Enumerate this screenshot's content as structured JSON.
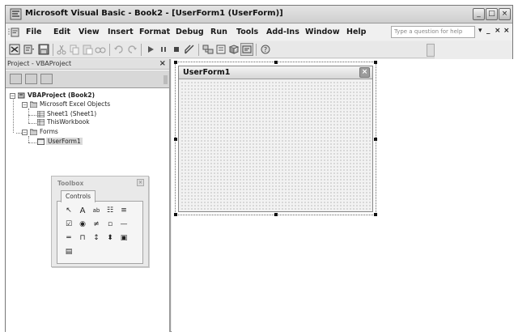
{
  "window": {
    "title": "Microsoft Visual Basic - Book2 - [UserForm1 (UserForm)]",
    "icon": "vba-app-icon"
  },
  "menubar": {
    "items": [
      "File",
      "Edit",
      "View",
      "Insert",
      "Format",
      "Debug",
      "Run",
      "Tools",
      "Add-Ins",
      "Window",
      "Help"
    ],
    "help_placeholder": "Type a question for help",
    "mdi_controls": [
      "▾",
      "_",
      "×",
      "×"
    ]
  },
  "window_buttons": [
    "_",
    "□",
    "×"
  ],
  "toolbar": {
    "icons": [
      "view-excel-icon",
      "insert-userform-icon",
      "save-icon",
      "cut-icon",
      "copy-icon",
      "paste-icon",
      "find-icon",
      "undo-icon",
      "redo-icon",
      "run-icon",
      "break-icon",
      "reset-icon",
      "design-mode-icon",
      "project-explorer-icon",
      "properties-icon",
      "object-browser-icon",
      "toolbox-icon",
      "help-icon"
    ]
  },
  "project_pane": {
    "title": "Project - VBAProject",
    "close": "×",
    "tree": {
      "root": "VBAProject (Book2)",
      "excel_objects": "Microsoft Excel Objects",
      "sheet1": "Sheet1 (Sheet1)",
      "thisworkbook": "ThisWorkbook",
      "forms": "Forms",
      "userform1": "UserForm1"
    }
  },
  "toolbox": {
    "title": "Toolbox",
    "tab": "Controls",
    "close": "×",
    "tools": [
      {
        "name": "select-objects-icon",
        "glyph": "↖"
      },
      {
        "name": "label-icon",
        "glyph": "A"
      },
      {
        "name": "textbox-icon",
        "glyph": "ab"
      },
      {
        "name": "combobox-icon",
        "glyph": "☷"
      },
      {
        "name": "listbox-icon",
        "glyph": "≡"
      },
      {
        "name": "checkbox-icon",
        "glyph": "☑"
      },
      {
        "name": "optionbutton-icon",
        "glyph": "◉"
      },
      {
        "name": "togglebutton-icon",
        "glyph": "≠"
      },
      {
        "name": "frame-icon",
        "glyph": "▫"
      },
      {
        "name": "commandbutton-icon",
        "glyph": "—"
      },
      {
        "name": "tabstrip-icon",
        "glyph": "═"
      },
      {
        "name": "multipage-icon",
        "glyph": "⊓"
      },
      {
        "name": "scrollbar-icon",
        "glyph": "↕"
      },
      {
        "name": "spinbutton-icon",
        "glyph": "⬍"
      },
      {
        "name": "image-icon",
        "glyph": "▣"
      },
      {
        "name": "refedit-icon",
        "glyph": "▤"
      }
    ]
  },
  "designer": {
    "form_title": "UserForm1",
    "close": "×"
  }
}
